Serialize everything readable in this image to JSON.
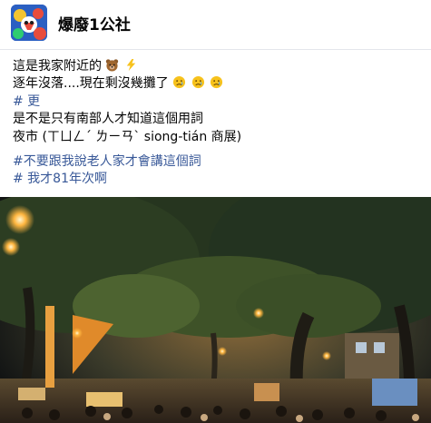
{
  "post": {
    "page_name": "爆廢1公社",
    "avatar_icon": "page-avatar-logo",
    "lines": [
      "這是我家附近的",
      "逐年沒落....現在剩沒幾攤了",
      "# 更",
      "是不是只有南部人才知道這個用詞",
      "夜市 (ㄒㄩㄥˊ ㄌㄧㄢˋ siong-tián 商展)"
    ],
    "hashtags": [
      "#不要跟我說老人家才會講這個詞",
      "# 我才81年次啊"
    ],
    "emojis": [
      "bear-emoji",
      "lightning-emoji",
      "sad-face-emoji",
      "sad-face-emoji",
      "sad-face-emoji"
    ]
  },
  "photo": {
    "subject": "night-market-street-photo"
  },
  "colors": {
    "text": "#050505",
    "link": "#385898",
    "divider": "#e4e6eb"
  }
}
